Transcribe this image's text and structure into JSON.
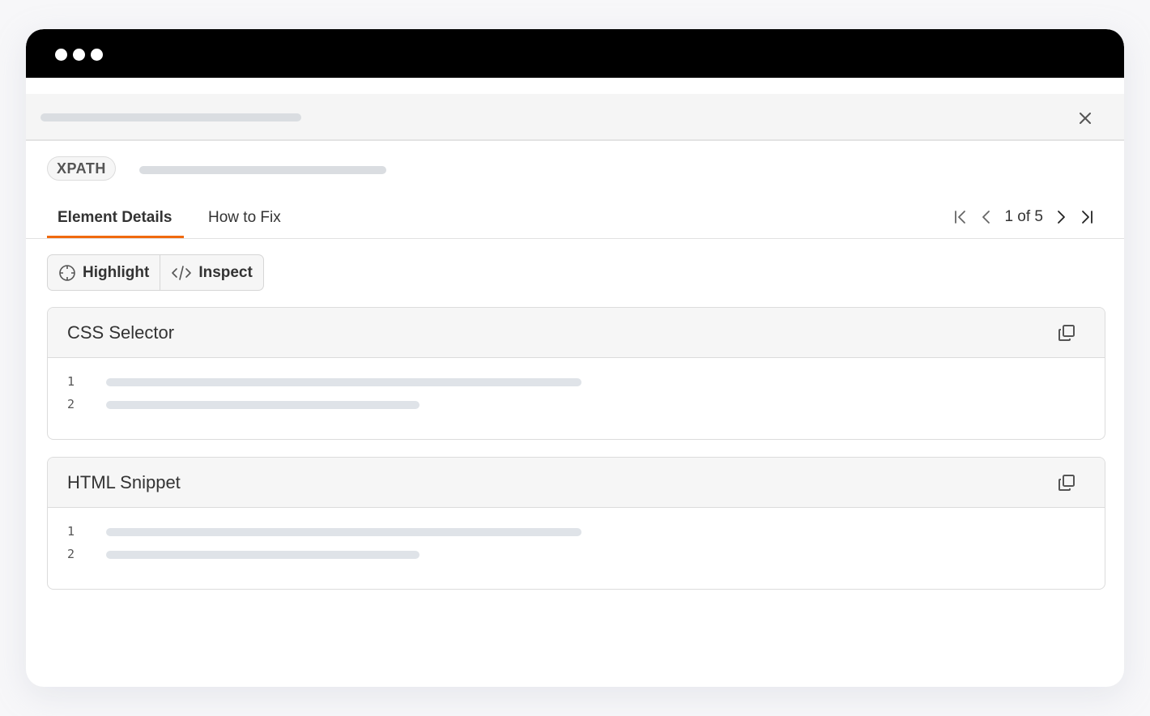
{
  "window": {
    "titlebar_dots": 3
  },
  "panel": {
    "close_icon": "close-icon"
  },
  "xpath": {
    "label": "XPATH"
  },
  "tabs": [
    {
      "label": "Element Details",
      "active": true
    },
    {
      "label": "How to Fix",
      "active": false
    }
  ],
  "pager": {
    "text": "1 of 5",
    "current": 1,
    "total": 5,
    "icons": [
      "first-page-icon",
      "previous-icon",
      "next-icon",
      "last-page-icon"
    ]
  },
  "actions": {
    "highlight_label": "Highlight",
    "inspect_label": "Inspect"
  },
  "cards": [
    {
      "title": "CSS Selector",
      "lines": [
        "1",
        "2"
      ]
    },
    {
      "title": "HTML Snippet",
      "lines": [
        "1",
        "2"
      ]
    }
  ],
  "colors": {
    "accent": "#f06a0f",
    "titlebar": "#000000",
    "skeleton": "#dadde1"
  }
}
